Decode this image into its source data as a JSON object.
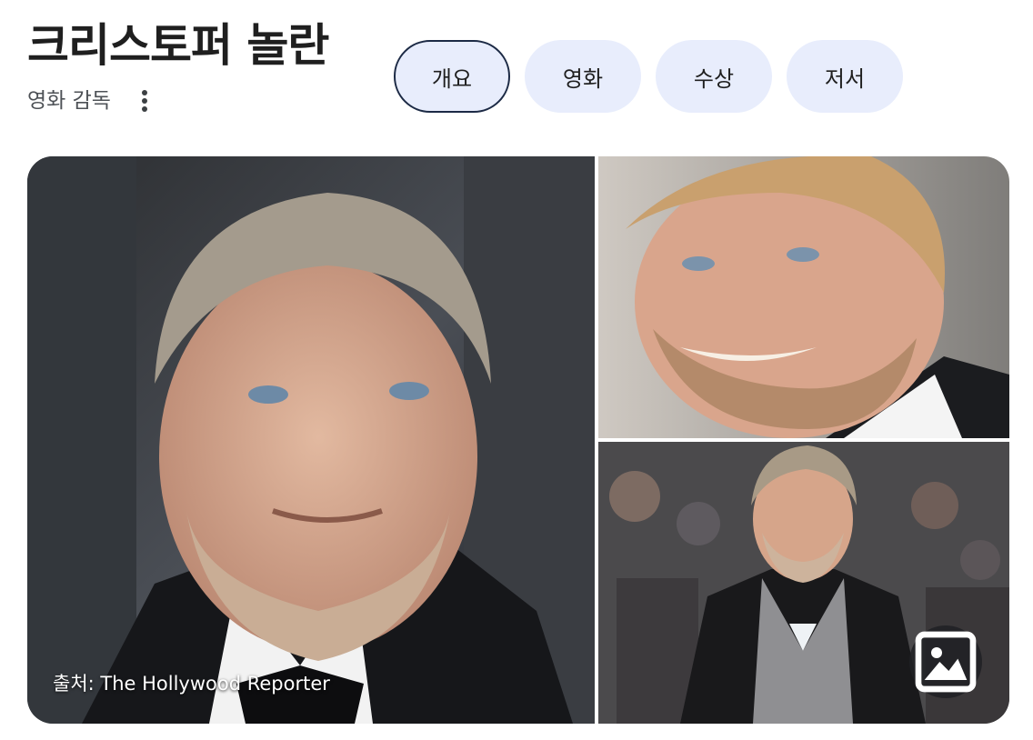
{
  "header": {
    "title": "크리스토퍼 놀란",
    "subtitle": "영화 감독",
    "more_icon": "more-vert-icon"
  },
  "tabs": [
    {
      "label": "개요",
      "active": true
    },
    {
      "label": "영화",
      "active": false
    },
    {
      "label": "수상",
      "active": false
    },
    {
      "label": "저서",
      "active": false
    }
  ],
  "gallery": {
    "source_caption": "출처: The Hollywood Reporter",
    "image_search_icon": "image-icon",
    "images": [
      {
        "kind": "photo"
      },
      {
        "kind": "photo"
      },
      {
        "kind": "photo"
      }
    ]
  },
  "colors": {
    "chip_bg": "#e8edfc",
    "chip_active_border": "#1c2a45",
    "text_primary": "#1f1f1f",
    "text_secondary": "#4d5156"
  }
}
